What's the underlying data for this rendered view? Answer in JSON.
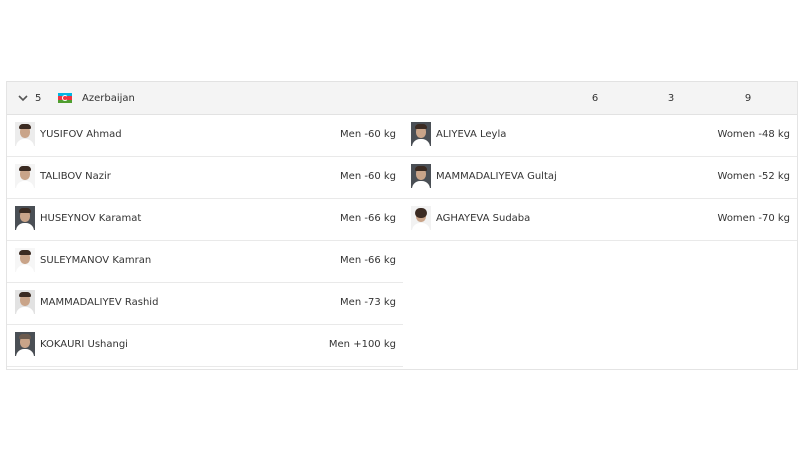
{
  "country_row": {
    "rank": "5",
    "country": "Azerbaijan",
    "flag_colors": [
      "#00b5e2",
      "#ef3340",
      "#509e2f"
    ],
    "gold": "6",
    "silver": "3",
    "bronze": "9"
  },
  "athletes_left": [
    {
      "name": "YUSIFOV Ahmad",
      "category": "Men -60 kg"
    },
    {
      "name": "TALIBOV Nazir",
      "category": "Men -60 kg"
    },
    {
      "name": "HUSEYNOV Karamat",
      "category": "Men -66 kg"
    },
    {
      "name": "SULEYMANOV Kamran",
      "category": "Men -66 kg"
    },
    {
      "name": "MAMMADALIYEV Rashid",
      "category": "Men -73 kg"
    },
    {
      "name": "KOKAURI Ushangi",
      "category": "Men +100 kg"
    }
  ],
  "athletes_right": [
    {
      "name": "ALIYEVA Leyla",
      "category": "Women -48 kg"
    },
    {
      "name": "MAMMADALIYEVA Gultaj",
      "category": "Women -52 kg"
    },
    {
      "name": "AGHAYEVA Sudaba",
      "category": "Women -70 kg"
    }
  ]
}
